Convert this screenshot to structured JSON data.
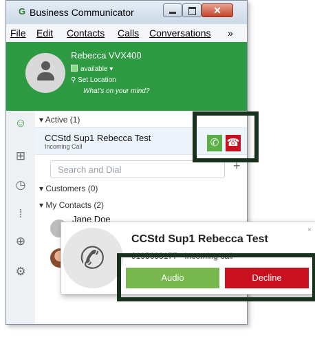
{
  "window": {
    "title": "Business Communicator",
    "app_icon": "communicator-app-icon",
    "controls": {
      "minimize": "minimize-icon",
      "maximize": "maximize-icon",
      "close": "✕"
    }
  },
  "menu": [
    "File",
    "Edit",
    "Contacts",
    "Calls",
    "Conversations",
    "»"
  ],
  "profile": {
    "name": "Rebecca VVX400",
    "status": "available ▾",
    "location": "Set Location",
    "mind": "What's on your mind?"
  },
  "sidebar_icons": [
    "contacts-icon",
    "dialpad-icon",
    "history-icon",
    "keypad-icon",
    "globe-icon",
    "settings-icon"
  ],
  "groups": {
    "active": "▾  Active (1)",
    "customers": "▾  Customers (0)",
    "my_contacts": "▾  My Contacts (2)"
  },
  "active_call": {
    "name": "CCStd Sup1 Rebecca Test",
    "sub": "Incoming Call",
    "accept_icon": "phone-accept-icon",
    "decline_icon": "phone-decline-icon"
  },
  "search": {
    "placeholder": "Search and Dial",
    "add": "+"
  },
  "contacts": [
    {
      "name": "Jane Doe"
    }
  ],
  "toast": {
    "title": "CCStd Sup1 Rebecca Test",
    "subtitle": "9195698177 - Incoming call",
    "audio": "Audio",
    "decline": "Decline",
    "close": "×"
  },
  "colors": {
    "green": "#2e9b43",
    "red": "#c8101e",
    "highlight": "#17311c",
    "audio_green": "#78b84f"
  }
}
